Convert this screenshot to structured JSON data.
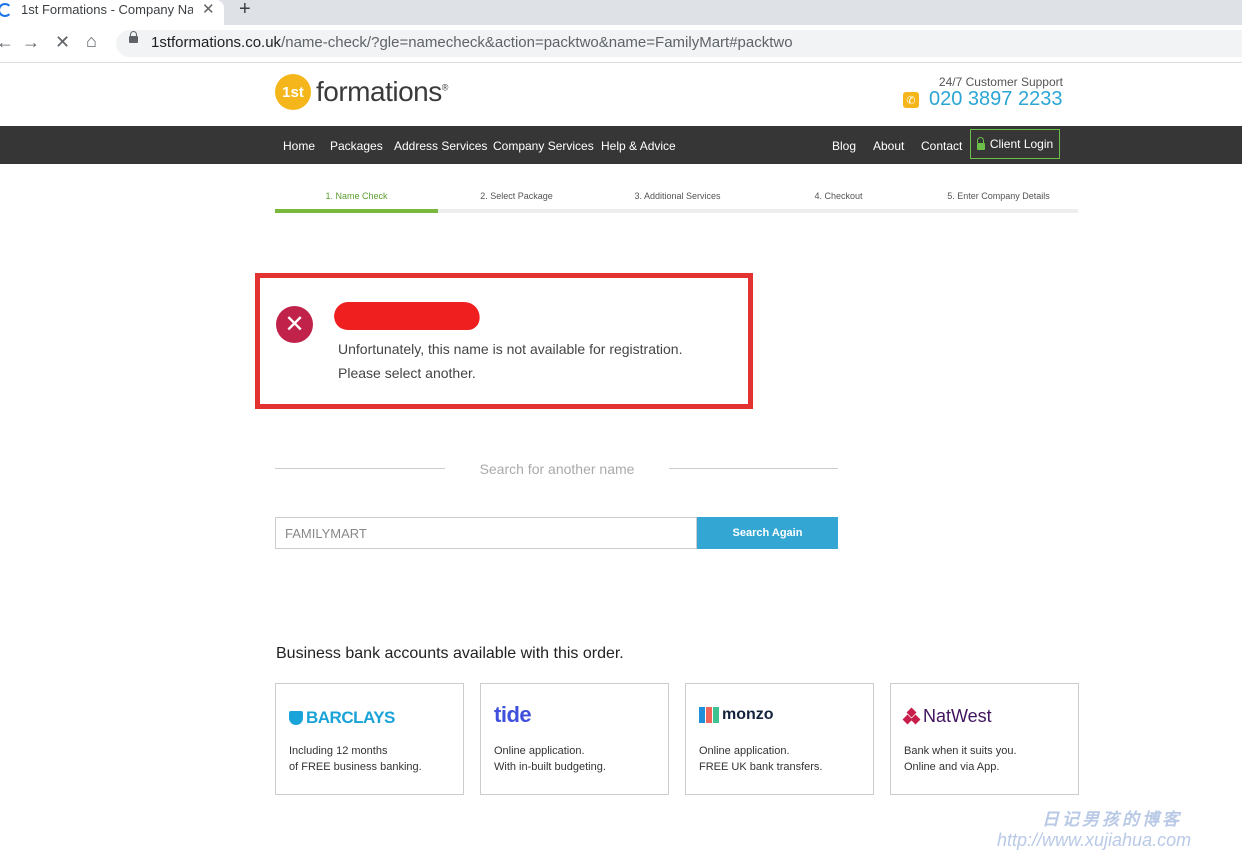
{
  "browser": {
    "tab_title": "1st Formations - Company Na",
    "tab_close": "✕",
    "new_tab": "+",
    "url_host": "1stformations.co.uk",
    "url_rest": "/name-check/?gle=namecheck&action=packtwo&name=FamilyMart#packtwo"
  },
  "header": {
    "logo_badge": "1st",
    "logo_text": "formations",
    "logo_mark": "®",
    "support_label": "24/7 Customer Support",
    "phone": "020 3897 2233"
  },
  "nav": {
    "left": [
      "Home",
      "Packages",
      "Address Services",
      "Company Services",
      "Help & Advice"
    ],
    "right": [
      "Blog",
      "About",
      "Contact"
    ],
    "login": "Client Login"
  },
  "steps": [
    "1. Name Check",
    "2. Select Package",
    "3. Additional Services",
    "4. Checkout",
    "5. Enter Company Details"
  ],
  "active_step": 1,
  "result": {
    "line1": "Unfortunately, this name is not available for registration.",
    "line2": "Please select another."
  },
  "search": {
    "label": "Search for another name",
    "value": "FAMILYMART",
    "button": "Search Again"
  },
  "banks": {
    "title": "Business bank accounts available with this order.",
    "cards": [
      {
        "name": "BARCLAYS",
        "line1": "Including 12 months",
        "line2": "of FREE business banking."
      },
      {
        "name": "tide",
        "line1": "Online application.",
        "line2": "With in-built budgeting."
      },
      {
        "name": "monzo",
        "line1": "Online application.",
        "line2": "FREE UK bank transfers."
      },
      {
        "name": "NatWest",
        "line1": "Bank when it suits you.",
        "line2": "Online and via App."
      }
    ]
  },
  "watermark": {
    "line1": "日记男孩的博客",
    "line2": "http://www.xujiahua.com"
  },
  "colors": {
    "accent_blue": "#33a6d4",
    "nav_bg": "#363636",
    "progress_green": "#7ab93d",
    "error_red": "#e33232",
    "error_icon": "#c1224a",
    "logo_yellow": "#f5b61b"
  }
}
